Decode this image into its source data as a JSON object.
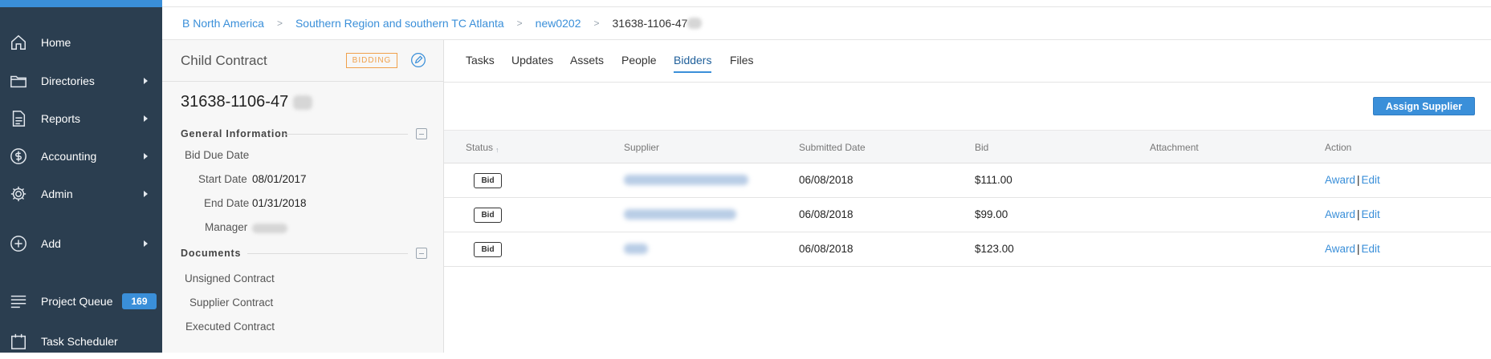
{
  "sidebar": {
    "items": [
      {
        "label": "Home",
        "icon": "home-icon"
      },
      {
        "label": "Directories",
        "icon": "folder-icon"
      },
      {
        "label": "Reports",
        "icon": "report-icon"
      },
      {
        "label": "Accounting",
        "icon": "dollar-icon"
      },
      {
        "label": "Admin",
        "icon": "gear-icon"
      },
      {
        "label": "Add",
        "icon": "plus-circle-icon"
      },
      {
        "label": "Project Queue",
        "icon": "list-icon",
        "badge": "169"
      },
      {
        "label": "Task Scheduler",
        "icon": "calendar-icon"
      }
    ]
  },
  "breadcrumb": {
    "items": [
      "B North America",
      "Southern Region and southern TC Atlanta",
      "new0202"
    ],
    "separator": ">",
    "current": "31638-1106-47"
  },
  "detail": {
    "title": "Child Contract",
    "status": "BIDDING",
    "contract_id": "31638-1106-47",
    "general_heading": "General Information",
    "bid_due_label": "Bid Due Date",
    "start_label": "Start Date",
    "start_value": "08/01/2017",
    "end_label": "End Date",
    "end_value": "01/31/2018",
    "manager_label": "Manager",
    "documents_heading": "Documents",
    "documents": [
      "Unsigned Contract",
      "Supplier Contract",
      "Executed Contract"
    ]
  },
  "tabs": [
    "Tasks",
    "Updates",
    "Assets",
    "People",
    "Bidders",
    "Files"
  ],
  "active_tab": "Bidders",
  "assign_button": "Assign Supplier",
  "table": {
    "headers": [
      "Status",
      "Supplier",
      "Submitted Date",
      "Bid",
      "Attachment",
      "Action"
    ],
    "rows": [
      {
        "status": "Bid",
        "date": "06/08/2018",
        "bid": "$111.00"
      },
      {
        "status": "Bid",
        "date": "06/08/2018",
        "bid": "$99.00"
      },
      {
        "status": "Bid",
        "date": "06/08/2018",
        "bid": "$123.00"
      }
    ],
    "action_award": "Award",
    "action_sep": "|",
    "action_edit": "Edit"
  },
  "colors": {
    "sidebar_bg": "#2b3e50",
    "accent": "#3a8fd9",
    "status_orange": "#f0a04b"
  }
}
